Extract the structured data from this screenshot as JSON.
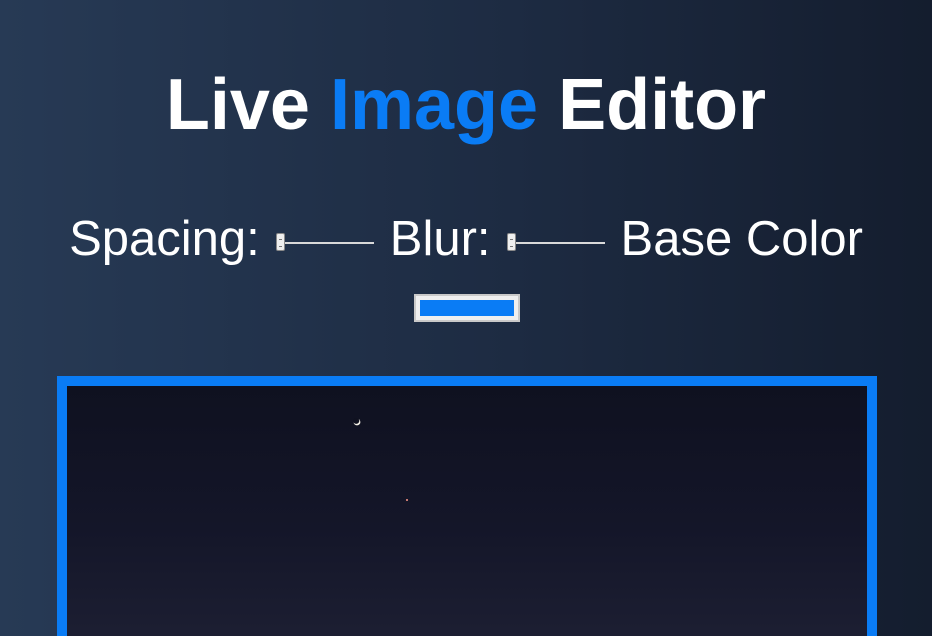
{
  "title": {
    "word1": "Live ",
    "word2": "Image",
    "word3": " Editor"
  },
  "controls": {
    "spacing_label": "Spacing:",
    "spacing_value": 0,
    "blur_label": "Blur:",
    "blur_value": 0,
    "base_color_label": "Base Color",
    "base_color_value": "#0a7cf5"
  },
  "colors": {
    "accent": "#0a7cf5",
    "text": "#ffffff",
    "background_dark": "#141d2e",
    "background_light": "#273a55"
  },
  "image": {
    "description_icons": [
      "moon-icon",
      "star-icon"
    ]
  }
}
